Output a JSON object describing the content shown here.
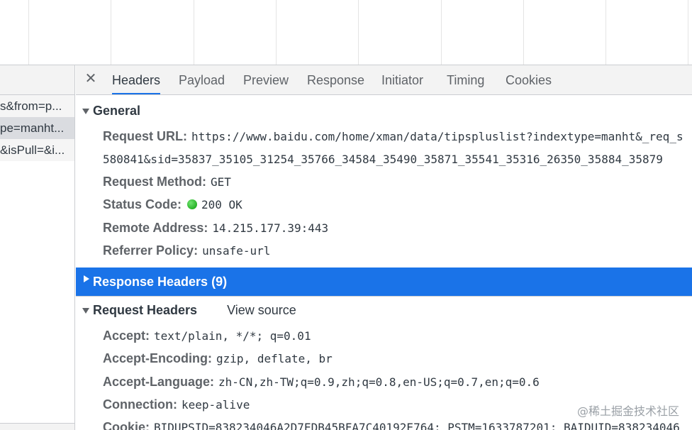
{
  "request_list": {
    "rows": [
      {
        "label": "s&from=p..."
      },
      {
        "label": "pe=manht..."
      },
      {
        "label": "&isPull=&i..."
      }
    ]
  },
  "tabs": [
    {
      "label": "Headers"
    },
    {
      "label": "Payload"
    },
    {
      "label": "Preview"
    },
    {
      "label": "Response"
    },
    {
      "label": "Initiator"
    },
    {
      "label": "Timing"
    },
    {
      "label": "Cookies"
    }
  ],
  "close_glyph": "✕",
  "general": {
    "title": "General",
    "request_url_key": "Request URL:",
    "request_url_line1": "https://www.baidu.com/home/xman/data/tipspluslist?indextype=manht&_req_s",
    "request_url_line2": "580841&sid=35837_35105_31254_35766_34584_35490_35871_35541_35316_26350_35884_35879",
    "request_method_key": "Request Method:",
    "request_method": "GET",
    "status_code_key": "Status Code:",
    "status_code": "200 OK",
    "remote_address_key": "Remote Address:",
    "remote_address": "14.215.177.39:443",
    "referrer_policy_key": "Referrer Policy:",
    "referrer_policy": "unsafe-url"
  },
  "response_headers": {
    "title": "Response Headers (9)"
  },
  "request_headers": {
    "title": "Request Headers",
    "view_source": "View source",
    "accept_key": "Accept:",
    "accept": "text/plain, */*; q=0.01",
    "accept_encoding_key": "Accept-Encoding:",
    "accept_encoding": "gzip, deflate, br",
    "accept_language_key": "Accept-Language:",
    "accept_language": "zh-CN,zh-TW;q=0.9,zh;q=0.8,en-US;q=0.7,en;q=0.6",
    "connection_key": "Connection:",
    "connection": "keep-alive",
    "cookie_key": "Cookie:",
    "cookie": "BIDUPSID=838234046A2D7EDB45BFA7C40192E764; PSTM=1633787201; BAIDUID=838234046"
  },
  "watermark": "@稀土掘金技术社区",
  "colors": {
    "accent": "#1a73e8",
    "status_ok": "#0a9d0a"
  }
}
